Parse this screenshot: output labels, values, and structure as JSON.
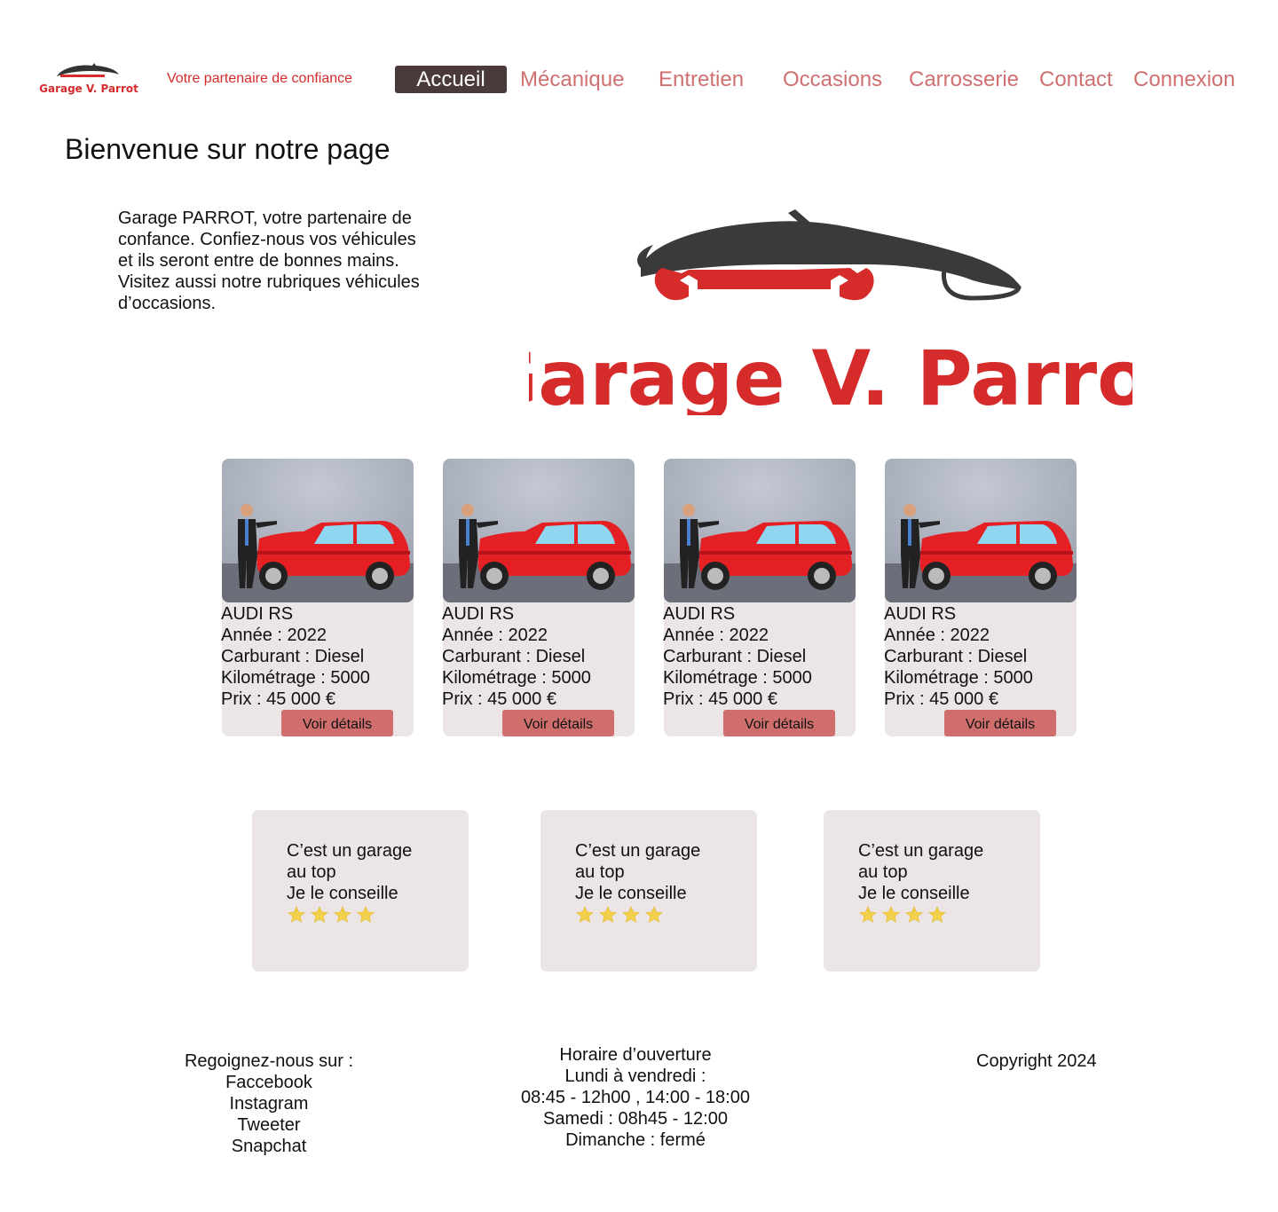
{
  "header": {
    "logo_text": "Garage V. Parrot",
    "tagline": "Votre partenaire de confiance",
    "nav": [
      {
        "label": "Accueil",
        "active": true
      },
      {
        "label": "Mécanique",
        "active": false
      },
      {
        "label": "Entretien",
        "active": false
      },
      {
        "label": "Occasions",
        "active": false
      },
      {
        "label": "Carrosserie",
        "active": false
      },
      {
        "label": "Contact",
        "active": false
      },
      {
        "label": "Connexion",
        "active": false
      }
    ]
  },
  "main": {
    "title": "Bienvenue sur notre page",
    "intro_lines": [
      "Garage PARROT, votre partenaire de",
      "confance. Confiez-nous vos véhicules",
      "et ils seront entre de bonnes mains.",
      "Visitez aussi notre rubriques véhicules",
      "d’occasions."
    ],
    "hero_logo_text": "Garage V. Parrot"
  },
  "cars": [
    {
      "name": "AUDI RS",
      "year": "Année : 2022",
      "fuel": "Carburant : Diesel",
      "km": "Kilométrage : 5000",
      "price": "Prix : 45 000 €",
      "button": "Voir détails"
    },
    {
      "name": "AUDI RS",
      "year": "Année : 2022",
      "fuel": "Carburant : Diesel",
      "km": "Kilométrage : 5000",
      "price": "Prix : 45 000 €",
      "button": "Voir détails"
    },
    {
      "name": "AUDI RS",
      "year": "Année : 2022",
      "fuel": "Carburant : Diesel",
      "km": "Kilométrage : 5000",
      "price": "Prix : 45 000 €",
      "button": "Voir détails"
    },
    {
      "name": "AUDI RS",
      "year": "Année : 2022",
      "fuel": "Carburant : Diesel",
      "km": "Kilométrage : 5000",
      "price": "Prix : 45 000 €",
      "button": "Voir détails"
    }
  ],
  "reviews": [
    {
      "line1": "C’est un garage",
      "line2": "au top",
      "line3": "Je le conseille",
      "rating": 4
    },
    {
      "line1": "C’est un garage",
      "line2": "au top",
      "line3": "Je le conseille",
      "rating": 4
    },
    {
      "line1": "C’est un garage",
      "line2": "au top",
      "line3": "Je le conseille",
      "rating": 4
    }
  ],
  "footer": {
    "social": {
      "title": "Regoignez-nous sur :",
      "links": [
        "Faccebook",
        "Instagram",
        "Tweeter",
        "Snapchat"
      ]
    },
    "hours": {
      "title": "Horaire d’ouverture",
      "lines": [
        "Lundi à vendredi :",
        "08:45 - 12h00 , 14:00 - 18:00",
        "Samedi : 08h45 - 12:00",
        "Dimanche : fermé"
      ]
    },
    "copyright": "Copyright 2024"
  },
  "colors": {
    "brand_red": "#d62b2b",
    "nav_text": "#d07070",
    "nav_active_bg": "#4a3a3a",
    "card_bg": "#ebe5e5",
    "button_bg": "#d06e6e",
    "star": "#f2d04b"
  }
}
